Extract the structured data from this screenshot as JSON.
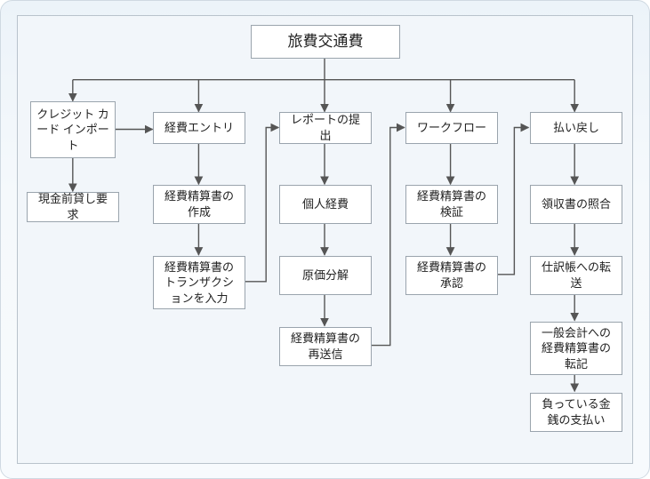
{
  "root": {
    "label": "旅費交通費"
  },
  "columns": {
    "import": {
      "head": "クレジット カード インポート",
      "r2": "現金前貸し要求"
    },
    "entry": {
      "head": "経費エントリ",
      "r2": "経費精算書の作成",
      "r3": "経費精算書のトランザクションを入力"
    },
    "report": {
      "head": "レポートの提出",
      "r2": "個人経費",
      "r3": "原価分解",
      "r4": "経費精算書の再送信"
    },
    "workflow": {
      "head": "ワークフロー",
      "r2": "経費精算書の検証",
      "r3": "経費精算書の承認"
    },
    "reimb": {
      "head": "払い戻し",
      "r2": "領収書の照合",
      "r3": "仕訳帳への転送",
      "r4": "一般会計への経費精算書の転記",
      "r5": "負っている金銭の支払い"
    }
  },
  "chart_data": {
    "type": "flowchart",
    "title": "旅費交通費",
    "root": "旅費交通費",
    "branches": [
      "クレジット カード インポート",
      "経費エントリ",
      "レポートの提出",
      "ワークフロー",
      "払い戻し"
    ],
    "edges_down": {
      "クレジット カード インポート": [
        "現金前貸し要求"
      ],
      "経費エントリ": [
        "経費精算書の作成",
        "経費精算書のトランザクションを入力"
      ],
      "レポートの提出": [
        "個人経費",
        "原価分解",
        "経費精算書の再送信"
      ],
      "ワークフロー": [
        "経費精算書の検証",
        "経費精算書の承認"
      ],
      "払い戻し": [
        "領収書の照合",
        "仕訳帳への転送",
        "一般会計への経費精算書の転記",
        "負っている金銭の支払い"
      ]
    },
    "edges_cross": [
      [
        "クレジット カード インポート",
        "経費エントリ"
      ],
      [
        "経費精算書のトランザクションを入力",
        "レポートの提出"
      ],
      [
        "経費精算書の再送信",
        "ワークフロー"
      ],
      [
        "経費精算書の承認",
        "払い戻し"
      ]
    ]
  }
}
